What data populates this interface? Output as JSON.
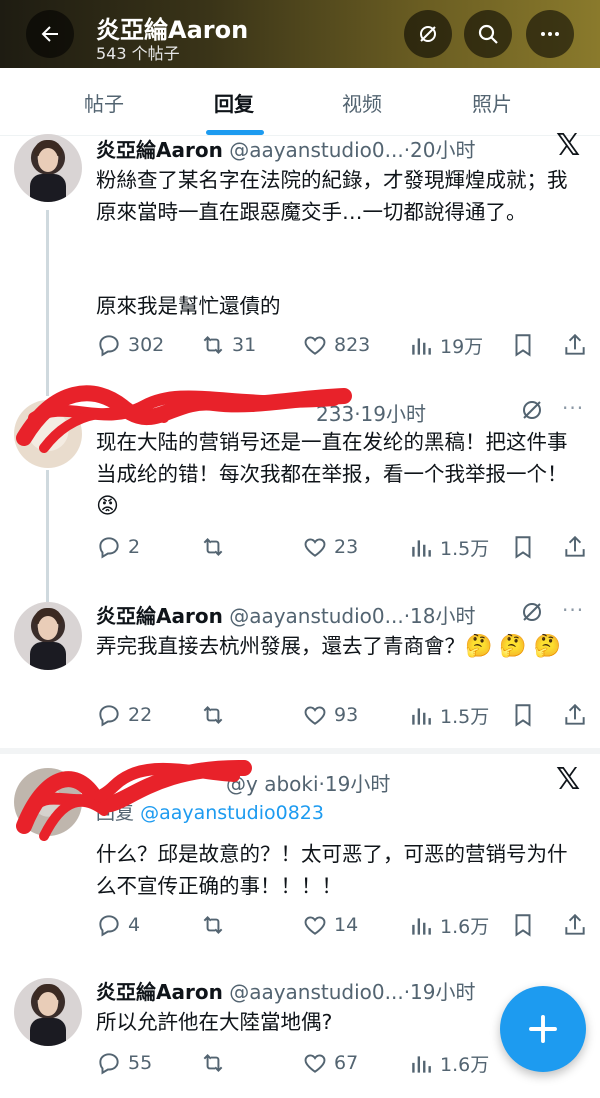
{
  "header": {
    "title": "炎亞綸Aaron",
    "subtitle": "543 个帖子"
  },
  "tabs": [
    {
      "label": "帖子",
      "active": false
    },
    {
      "label": "回复",
      "active": true
    },
    {
      "label": "视频",
      "active": false
    },
    {
      "label": "照片",
      "active": false
    }
  ],
  "posts": [
    {
      "name": "炎亞綸Aaron",
      "handle": "@aayanstudio0...",
      "time": "·20小时",
      "text": "粉絲查了某名字在法院的紀錄，才發現輝煌成就；我原來當時一直在跟惡魔交手…一切都說得通了。",
      "text2": "原來我是幫忙還債的",
      "replies": "302",
      "retweets": "31",
      "likes": "823",
      "views": "19万"
    },
    {
      "name": "",
      "handle": "233",
      "time": "·19小时",
      "text": "现在大陆的营销号还是一直在发纶的黑稿！把这件事当成纶的错！每次我都在举报，看一个我举报一个！",
      "emoji": "😡",
      "replies": "2",
      "retweets": "",
      "likes": "23",
      "views": "1.5万"
    },
    {
      "name": "炎亞綸Aaron",
      "handle": "@aayanstudio0...",
      "time": "·18小时",
      "text": "弄完我直接去杭州發展，還去了青商會？",
      "emoji": "🤔 🤔 🤔",
      "replies": "22",
      "retweets": "",
      "likes": "93",
      "views": "1.5万"
    },
    {
      "name": "",
      "handle": "@y aboki",
      "time": "·19小时",
      "reply_label": "回复",
      "reply_to": "@aayanstudio0823",
      "text": "什么？邱是故意的？！太可恶了，可恶的营销号为什么不宣传正确的事！！！！",
      "replies": "4",
      "retweets": "",
      "likes": "14",
      "views": "1.6万"
    },
    {
      "name": "炎亞綸Aaron",
      "handle": "@aayanstudio0...",
      "time": "·19小时",
      "text": "所以允許他在大陸當地偶?",
      "replies": "55",
      "retweets": "",
      "likes": "67",
      "views": "1.6万"
    }
  ],
  "icons": {
    "back": "arrow-left-icon",
    "grok": "grok-icon",
    "search": "search-icon",
    "more": "more-icon",
    "x": "x-logo-icon",
    "fab": "plus-icon"
  },
  "colors": {
    "accent": "#1d9bf0",
    "text": "#0f1419",
    "muted": "#536471"
  }
}
